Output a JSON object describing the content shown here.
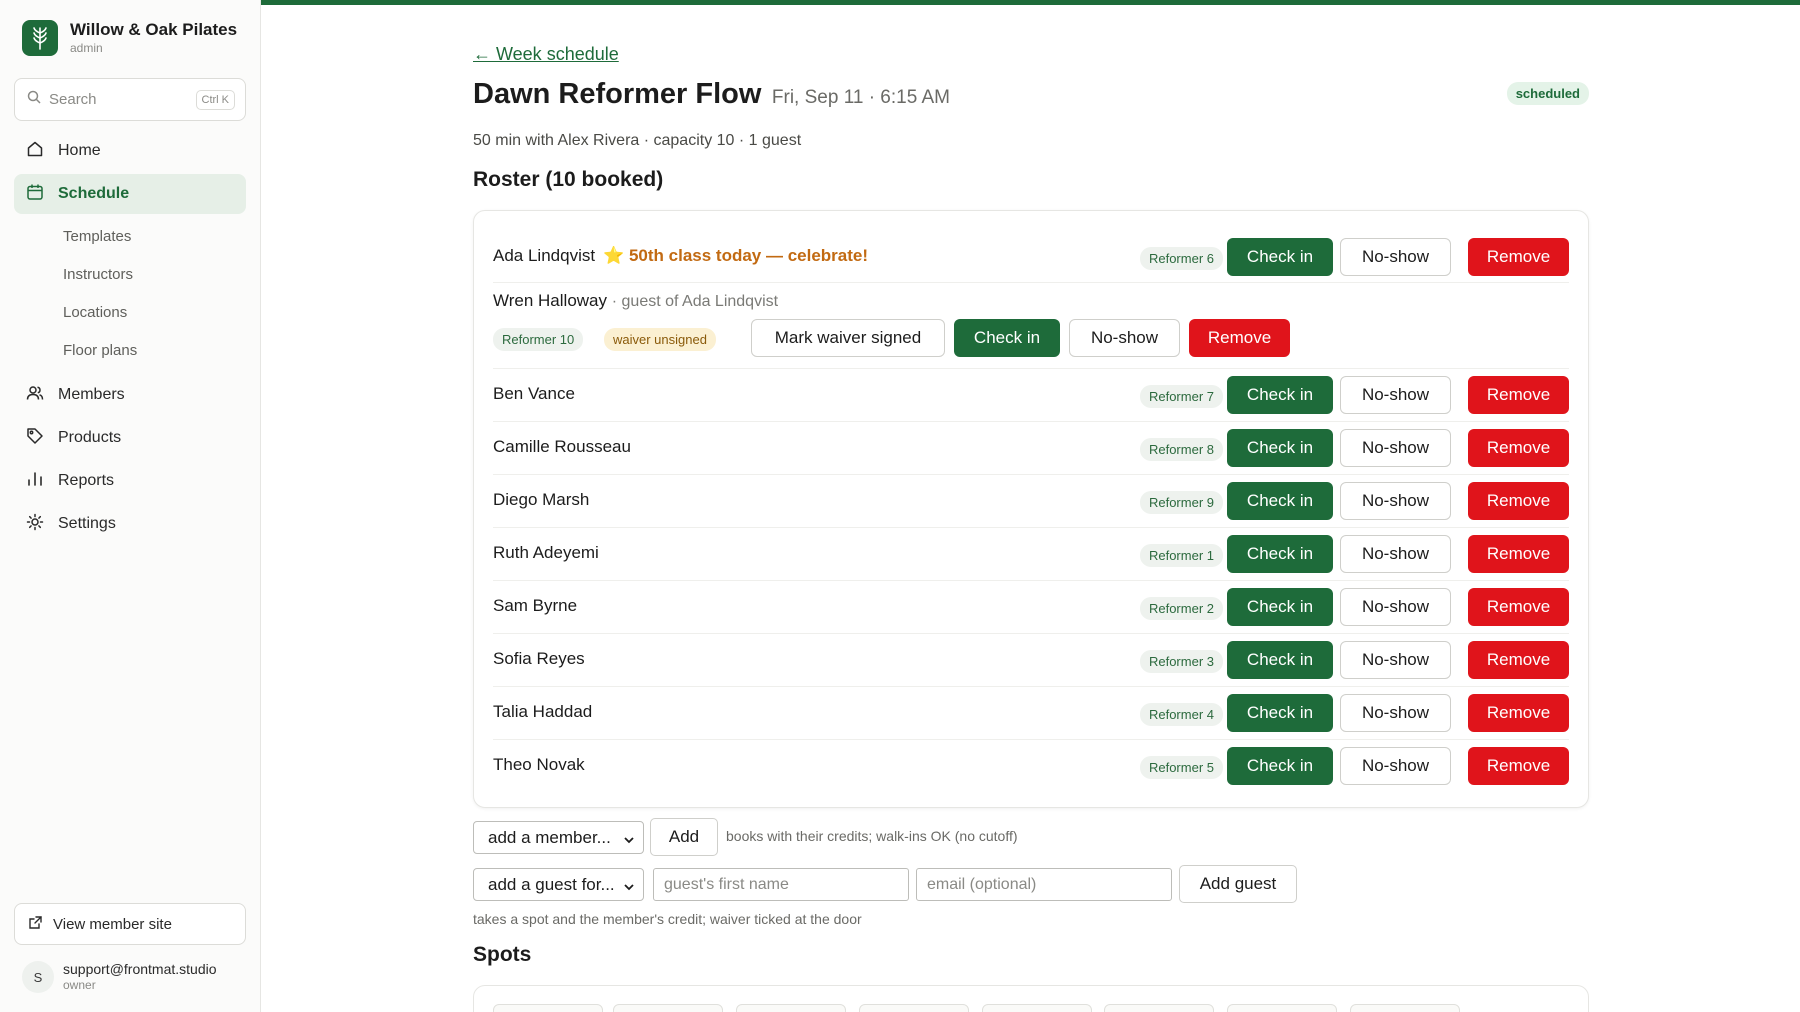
{
  "brand": {
    "name": "Willow & Oak Pilates",
    "role": "admin"
  },
  "search": {
    "placeholder": "Search",
    "shortcut": "Ctrl K"
  },
  "nav": {
    "home": "Home",
    "schedule": "Schedule",
    "templates": "Templates",
    "instructors": "Instructors",
    "locations": "Locations",
    "floor_plans": "Floor plans",
    "members": "Members",
    "products": "Products",
    "reports": "Reports",
    "settings": "Settings"
  },
  "footer": {
    "member_site": "View member site",
    "user_initial": "S",
    "user_email": "support@frontmat.studio",
    "user_role": "owner"
  },
  "class": {
    "back": "← Week schedule",
    "title": "Dawn Reformer Flow",
    "date": "Fri, Sep 11 · 6:15 AM",
    "status": "scheduled",
    "subtitle": "50 min with Alex Rivera · capacity 10 · 1 guest"
  },
  "roster": {
    "heading": "Roster (10 booked)",
    "check_in": "Check in",
    "no_show": "No-show",
    "remove": "Remove",
    "mark_waiver": "Mark waiver signed",
    "waiver_unsigned": "waiver unsigned",
    "rows": [
      {
        "name": "Ada Lindqvist",
        "note": "⭐ 50th class today — celebrate!",
        "spot": "Reformer 6"
      },
      {
        "name": "Wren Halloway",
        "note": "· guest of Ada Lindqvist",
        "spot": "Reformer 10"
      },
      {
        "name": "Ben Vance",
        "spot": "Reformer 7"
      },
      {
        "name": "Camille Rousseau",
        "spot": "Reformer 8"
      },
      {
        "name": "Diego Marsh",
        "spot": "Reformer 9"
      },
      {
        "name": "Ruth Adeyemi",
        "spot": "Reformer 1"
      },
      {
        "name": "Sam Byrne",
        "spot": "Reformer 2"
      },
      {
        "name": "Sofia Reyes",
        "spot": "Reformer 3"
      },
      {
        "name": "Talia Haddad",
        "spot": "Reformer 4"
      },
      {
        "name": "Theo Novak",
        "spot": "Reformer 5"
      }
    ]
  },
  "add_member": {
    "select": "add a member...",
    "button": "Add",
    "hint": "books with their credits; walk-ins OK (no cutoff)"
  },
  "add_guest": {
    "select": "add a guest for...",
    "name_placeholder": "guest's first name",
    "email_placeholder": "email (optional)",
    "button": "Add guest",
    "hint": "takes a spot and the member's credit; waiver ticked at the door"
  },
  "spots": {
    "heading": "Spots"
  },
  "colors": {
    "brand": "#1e6b3a",
    "danger": "#e0141b",
    "celebrate": "#c26a12"
  }
}
